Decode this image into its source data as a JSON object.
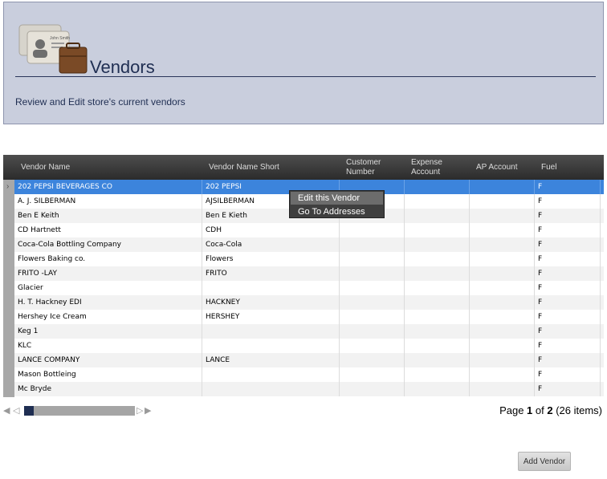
{
  "header": {
    "title": "Vendors",
    "subtitle": "Review and Edit store's current vendors",
    "logo_card_name": "John Smith",
    "icon": "vendor-cards-briefcase-icon"
  },
  "grid": {
    "columns": [
      {
        "label": "Vendor Name"
      },
      {
        "label": "Vendor Name Short"
      },
      {
        "label": "Customer Number"
      },
      {
        "label": "Expense Account"
      },
      {
        "label": "AP Account"
      },
      {
        "label": "Fuel"
      }
    ],
    "rows": [
      {
        "name": "202 PEPSI BEVERAGES CO",
        "short": "202 PEPSI",
        "customer": "",
        "expense": "",
        "ap": "",
        "fuel": "F"
      },
      {
        "name": "A. J. SILBERMAN",
        "short": "AJSILBERMAN",
        "customer": "",
        "expense": "",
        "ap": "",
        "fuel": "F"
      },
      {
        "name": "Ben E Keith",
        "short": "Ben E Kieth",
        "customer": "",
        "expense": "",
        "ap": "",
        "fuel": "F"
      },
      {
        "name": "CD Hartnett",
        "short": "CDH",
        "customer": "",
        "expense": "",
        "ap": "",
        "fuel": "F"
      },
      {
        "name": "Coca-Cola Bottling Company",
        "short": "Coca-Cola",
        "customer": "",
        "expense": "",
        "ap": "",
        "fuel": "F"
      },
      {
        "name": "Flowers Baking co.",
        "short": "Flowers",
        "customer": "",
        "expense": "",
        "ap": "",
        "fuel": "F"
      },
      {
        "name": "FRITO -LAY",
        "short": "FRITO",
        "customer": "",
        "expense": "",
        "ap": "",
        "fuel": "F"
      },
      {
        "name": "Glacier",
        "short": "",
        "customer": "",
        "expense": "",
        "ap": "",
        "fuel": "F"
      },
      {
        "name": "H. T. Hackney EDI",
        "short": "HACKNEY",
        "customer": "",
        "expense": "",
        "ap": "",
        "fuel": "F"
      },
      {
        "name": "Hershey Ice Cream",
        "short": "HERSHEY",
        "customer": "",
        "expense": "",
        "ap": "",
        "fuel": "F"
      },
      {
        "name": "Keg 1",
        "short": "",
        "customer": "",
        "expense": "",
        "ap": "",
        "fuel": "F"
      },
      {
        "name": "KLC",
        "short": "",
        "customer": "",
        "expense": "",
        "ap": "",
        "fuel": "F"
      },
      {
        "name": "LANCE COMPANY",
        "short": "LANCE",
        "customer": "",
        "expense": "",
        "ap": "",
        "fuel": "F"
      },
      {
        "name": "Mason Bottleing",
        "short": "",
        "customer": "",
        "expense": "",
        "ap": "",
        "fuel": "F"
      },
      {
        "name": "Mc Bryde",
        "short": "",
        "customer": "",
        "expense": "",
        "ap": "",
        "fuel": "F"
      }
    ],
    "selected_index": 0,
    "selection_color": "#3c84dc"
  },
  "context_menu": {
    "items": [
      {
        "label": "Edit this Vendor"
      },
      {
        "label": "Go To Addresses"
      }
    ]
  },
  "pager": {
    "prefix": "Page ",
    "current": "1",
    "of": " of ",
    "total": "2",
    "items": " (26 items)",
    "scroll_fraction": 0.0
  },
  "actions": {
    "add_vendor_label": "Add Vendor"
  }
}
